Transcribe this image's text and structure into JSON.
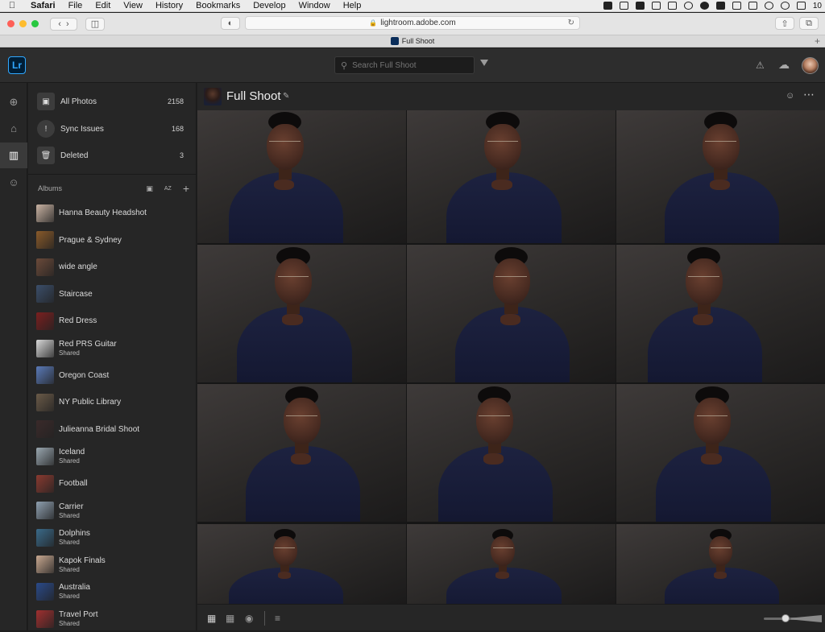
{
  "menubar": {
    "items": [
      "Safari",
      "File",
      "Edit",
      "View",
      "History",
      "Bookmarks",
      "Develop",
      "Window",
      "Help"
    ],
    "clock": "10"
  },
  "browser": {
    "url": "lightroom.adobe.com",
    "tab_title": "Full Shoot",
    "colors": {
      "close": "#fe5f57",
      "minimize": "#febc2e",
      "zoom": "#28c840"
    }
  },
  "app": {
    "logo": "Lr",
    "search_placeholder": "Search Full Shoot"
  },
  "library": [
    {
      "label": "All Photos",
      "count": "2158",
      "icon": "photos-icon"
    },
    {
      "label": "Sync Issues",
      "count": "168",
      "icon": "alert-icon"
    },
    {
      "label": "Deleted",
      "count": "3",
      "icon": "trash-icon"
    }
  ],
  "albums": {
    "header": "Albums",
    "sort_label": "AZ",
    "items": [
      {
        "name": "Hanna Beauty Headshot",
        "sub": "",
        "color": "#c9b3a3"
      },
      {
        "name": "Prague & Sydney",
        "sub": "",
        "color": "#8a5a2a"
      },
      {
        "name": "wide angle",
        "sub": "",
        "color": "#6b4a3a"
      },
      {
        "name": "Staircase",
        "sub": "",
        "color": "#3b4e6a"
      },
      {
        "name": "Red Dress",
        "sub": "",
        "color": "#7a1f1f"
      },
      {
        "name": "Red PRS Guitar",
        "sub": "Shared",
        "color": "#d8d8d8"
      },
      {
        "name": "Oregon Coast",
        "sub": "",
        "color": "#5a7ab8"
      },
      {
        "name": "NY Public Library",
        "sub": "",
        "color": "#6a5a48"
      },
      {
        "name": "Julieanna Bridal Shoot",
        "sub": "",
        "color": "#3a2a2a"
      },
      {
        "name": "Iceland",
        "sub": "Shared",
        "color": "#9aa7b0"
      },
      {
        "name": "Football",
        "sub": "",
        "color": "#8a3a30"
      },
      {
        "name": "Carrier",
        "sub": "Shared",
        "color": "#8fa0b0"
      },
      {
        "name": "Dolphins",
        "sub": "Shared",
        "color": "#3a6a8a"
      },
      {
        "name": "Kapok Finals",
        "sub": "Shared",
        "color": "#c8a890"
      },
      {
        "name": "Australia",
        "sub": "Shared",
        "color": "#2a4a8a"
      },
      {
        "name": "Travel Port",
        "sub": "Shared",
        "color": "#a03030"
      }
    ]
  },
  "main": {
    "title": "Full Shoot"
  }
}
